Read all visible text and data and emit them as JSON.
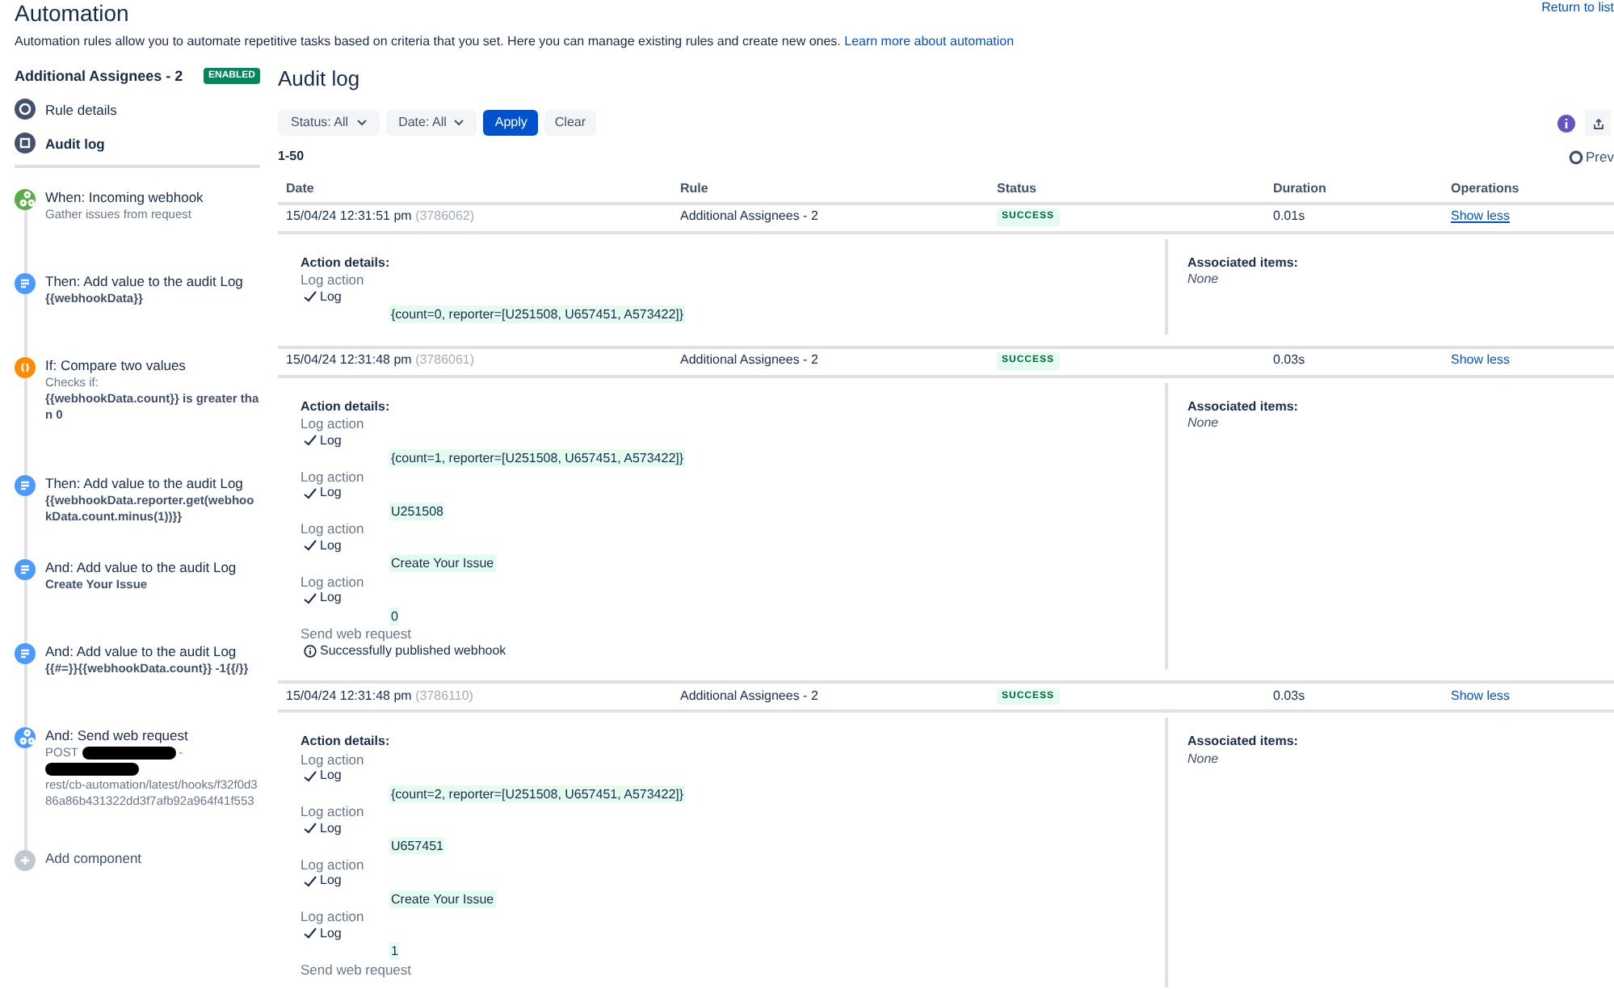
{
  "header": {
    "title": "Automation",
    "description": "Automation rules allow you to automate repetitive tasks based on criteria that you set. Here you can manage existing rules and create new ones.",
    "learn_more_link": "Learn more about automation",
    "return_link": "Return to list"
  },
  "rule": {
    "name": "Additional Assignees - 2",
    "status_badge": "ENABLED"
  },
  "nav": [
    {
      "label": "Rule details",
      "selected": false
    },
    {
      "label": "Audit log",
      "selected": true
    }
  ],
  "components": [
    {
      "kind": "trigger",
      "title": "When: Incoming webhook",
      "details": [
        {
          "text": "Gather issues from request",
          "strong": false
        }
      ]
    },
    {
      "kind": "action",
      "title": "Then: Add value to the audit Log",
      "details": [
        {
          "text": "{{webhookData}}",
          "strong": true
        }
      ]
    },
    {
      "kind": "condition",
      "title": "If: Compare two values",
      "details": [
        {
          "text": "Checks if:",
          "strong": false
        },
        {
          "text": "{{webhookData.count}} is greater than 0",
          "strong": true
        }
      ]
    },
    {
      "kind": "action",
      "title": "Then: Add value to the audit Log",
      "details": [
        {
          "text": "{{webhookData.reporter.get(webhookData.count.minus(1))}}",
          "strong": true
        }
      ]
    },
    {
      "kind": "action",
      "title": "And: Add value to the audit Log",
      "details": [
        {
          "text": "Create Your Issue",
          "strong": true
        }
      ]
    },
    {
      "kind": "action",
      "title": "And: Add value to the audit Log",
      "details": [
        {
          "text": "{{#=}}{{webhookData.count}} -1{{/}}",
          "strong": true
        }
      ]
    },
    {
      "kind": "web_request",
      "title": "And: Send web request",
      "segments": [
        {
          "kind": "text",
          "text": "POST"
        },
        {
          "kind": "redacted"
        },
        {
          "kind": "text",
          "text": "-"
        },
        {
          "kind": "redacted"
        },
        {
          "kind": "text",
          "text": "rest/cb-automation/latest/hooks/f32f0d386a86b431322dd3f7afb92a964f41f553"
        }
      ]
    },
    {
      "kind": "add",
      "title": "Add component"
    }
  ],
  "audit_log": {
    "title": "Audit log",
    "filters": [
      "Status: All",
      "Date: All"
    ],
    "apply_button": "Apply",
    "clear_button": "Clear",
    "range": "1-50",
    "prev_button": "Prev",
    "columns": [
      "Date",
      "Rule",
      "Status",
      "Duration",
      "Operations"
    ],
    "entries": [
      {
        "date": "15/04/24 12:31:51 pm",
        "id": "(3786062)",
        "rule": "Additional Assignees - 2",
        "status": "SUCCESS",
        "duration": "0.01s",
        "operation": "Show less",
        "focused": true,
        "details_label": "Action details:",
        "associated_label": "Associated items:",
        "associated_value": "None",
        "actions": [
          {
            "kind": "log",
            "name": "Log action",
            "result": "Log",
            "value": "{count=0, reporter=[U251508, U657451, A573422]}"
          }
        ]
      },
      {
        "date": "15/04/24 12:31:48 pm",
        "id": "(3786061)",
        "rule": "Additional Assignees - 2",
        "status": "SUCCESS",
        "duration": "0.03s",
        "operation": "Show less",
        "focused": false,
        "details_label": "Action details:",
        "associated_label": "Associated items:",
        "associated_value": "None",
        "actions": [
          {
            "kind": "log",
            "name": "Log action",
            "result": "Log",
            "value": "{count=1, reporter=[U251508, U657451, A573422]}"
          },
          {
            "kind": "log",
            "name": "Log action",
            "result": "Log",
            "value": "U251508"
          },
          {
            "kind": "log",
            "name": "Log action",
            "result": "Log",
            "value": "Create Your Issue"
          },
          {
            "kind": "log",
            "name": "Log action",
            "result": "Log",
            "value": "0"
          },
          {
            "kind": "web_request",
            "name": "Send web request",
            "message": "Successfully published webhook"
          }
        ]
      },
      {
        "date": "15/04/24 12:31:48 pm",
        "id": "(3786110)",
        "rule": "Additional Assignees - 2",
        "status": "SUCCESS",
        "duration": "0.03s",
        "operation": "Show less",
        "focused": false,
        "details_label": "Action details:",
        "associated_label": "Associated items:",
        "associated_value": "None",
        "actions": [
          {
            "kind": "log",
            "name": "Log action",
            "result": "Log",
            "value": "{count=2, reporter=[U251508, U657451, A573422]}"
          },
          {
            "kind": "log",
            "name": "Log action",
            "result": "Log",
            "value": "U657451"
          },
          {
            "kind": "log",
            "name": "Log action",
            "result": "Log",
            "value": "Create Your Issue"
          },
          {
            "kind": "log",
            "name": "Log action",
            "result": "Log",
            "value": "1"
          },
          {
            "kind": "web_request",
            "name": "Send web request"
          }
        ]
      }
    ]
  }
}
